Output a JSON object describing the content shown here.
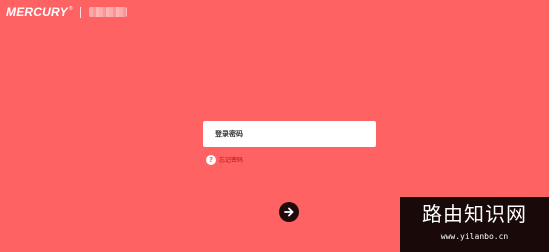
{
  "header": {
    "logo_text": "MERCURY",
    "logo_registered": "®"
  },
  "login": {
    "password_placeholder": "登录密码",
    "password_value": "",
    "forgot_label": "忘记密码",
    "forgot_icon": "?",
    "submit_icon": "arrow-right-icon"
  },
  "watermark": {
    "title": "路由知识网",
    "url": "www.yilanbo.cn"
  },
  "colors": {
    "background": "#fe6262",
    "input_bg": "#ffffff",
    "forgot_text": "#b80e0e",
    "button_bg": "#1f0b0b",
    "watermark_bg": "#000000"
  }
}
